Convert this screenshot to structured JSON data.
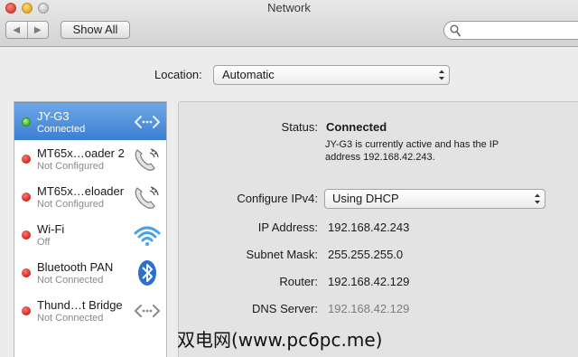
{
  "window": {
    "title": "Network"
  },
  "toolbar": {
    "back_glyph": "◀",
    "forward_glyph": "▶",
    "show_all_label": "Show All",
    "search_placeholder": ""
  },
  "location": {
    "label": "Location:",
    "value": "Automatic"
  },
  "services": [
    {
      "name": "JY-G3",
      "status": "Connected",
      "state": "green",
      "icon": "ethernet-arrows-icon",
      "selected": true
    },
    {
      "name": "MT65x…oader 2",
      "status": "Not Configured",
      "state": "red",
      "icon": "modem-phone-icon",
      "selected": false
    },
    {
      "name": "MT65x…eloader",
      "status": "Not Configured",
      "state": "red",
      "icon": "modem-phone-icon",
      "selected": false
    },
    {
      "name": "Wi-Fi",
      "status": "Off",
      "state": "red",
      "icon": "wifi-icon",
      "selected": false
    },
    {
      "name": "Bluetooth PAN",
      "status": "Not Connected",
      "state": "red",
      "icon": "bluetooth-icon",
      "selected": false
    },
    {
      "name": "Thund…t Bridge",
      "status": "Not Connected",
      "state": "red",
      "icon": "ethernet-arrows-icon",
      "selected": false
    }
  ],
  "details": {
    "status_label": "Status:",
    "status_value": "Connected",
    "status_desc_line1": "JY-G3 is currently active and has the IP",
    "status_desc_line2": "address 192.168.42.243.",
    "configure_label": "Configure IPv4:",
    "configure_value": "Using DHCP",
    "ip_label": "IP Address:",
    "ip_value": "192.168.42.243",
    "subnet_label": "Subnet Mask:",
    "subnet_value": "255.255.255.0",
    "router_label": "Router:",
    "router_value": "192.168.42.129",
    "dns_label": "DNS Server:",
    "dns_value": "192.168.42.129"
  },
  "watermark": "双电网(www.pc6pc.me)",
  "colors": {
    "selection": "#3b7fd3",
    "status_red": "#d2221a",
    "status_green": "#3fb52a",
    "window_bg": "#ececec"
  }
}
